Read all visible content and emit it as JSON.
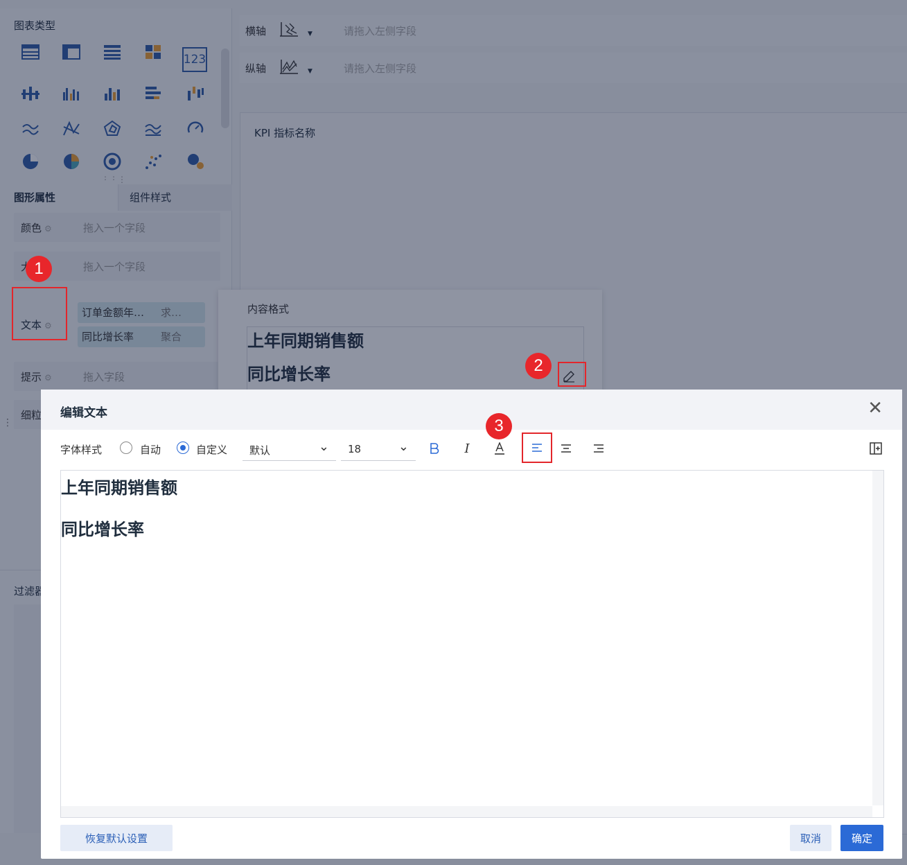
{
  "left_panel": {
    "chart_type_title": "图表类型",
    "kpi_icon_label": "123",
    "tabs": [
      {
        "label": "图形属性"
      },
      {
        "label": "组件样式"
      }
    ],
    "fields": [
      {
        "label": "颜色",
        "placeholder": "拖入一个字段"
      },
      {
        "label": "大",
        "placeholder": "拖入一个字段"
      },
      {
        "label": "文本"
      },
      {
        "label": "提示",
        "placeholder": "拖入字段"
      },
      {
        "label": "细粒"
      }
    ],
    "text_pills": [
      {
        "name": "订单金额年…",
        "agg": "求…"
      },
      {
        "name": "同比增长率",
        "agg": "聚合"
      }
    ],
    "filter_label": "过滤器"
  },
  "axes": {
    "x": {
      "label": "横轴",
      "placeholder": "请拖入左侧字段"
    },
    "y": {
      "label": "纵轴",
      "placeholder": "请拖入左侧字段"
    }
  },
  "canvas": {
    "kpi_title": "KPI 指标名称"
  },
  "popover": {
    "title": "内容格式",
    "lines": [
      "上年同期销售额",
      "同比增长率"
    ]
  },
  "annotations": {
    "b1": "1",
    "b2": "2",
    "b3": "3",
    "color": "#e3262b"
  },
  "modal": {
    "title": "编辑文本",
    "font_style_label": "字体样式",
    "radio_auto": "自动",
    "radio_custom": "自定义",
    "font_select": "默认",
    "size_select": "18",
    "editor_lines": [
      "上年同期销售额",
      "同比增长率"
    ],
    "reset_button": "恢复默认设置",
    "cancel_button": "取消",
    "ok_button": "确定",
    "accent_color": "#2b6ad6"
  }
}
